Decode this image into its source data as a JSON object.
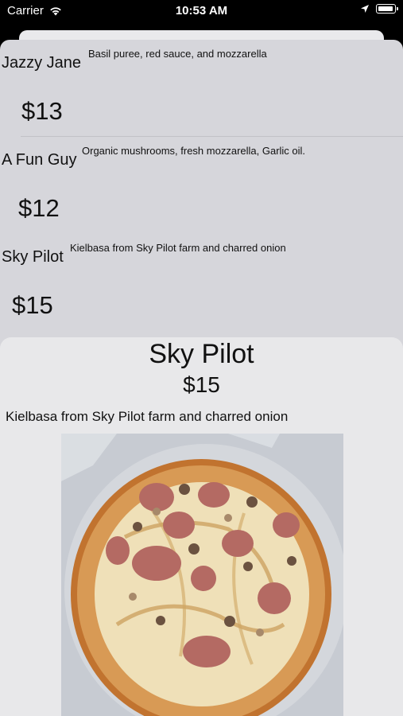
{
  "status_bar": {
    "carrier": "Carrier",
    "time": "10:53 AM"
  },
  "pizza_list": [
    {
      "name": "Jazzy Jane",
      "description": "Basil puree, red sauce, and mozzarella",
      "price": "$13"
    },
    {
      "name": "A Fun Guy",
      "description": "Organic mushrooms, fresh mozzarella, Garlic oil.",
      "price": "$12"
    },
    {
      "name": "Sky Pilot",
      "description": "Kielbasa from Sky Pilot farm and charred onion",
      "price": "$15"
    }
  ],
  "detail": {
    "title": "Sky Pilot",
    "price": "$15",
    "description": "Kielbasa from Sky Pilot farm and charred onion",
    "image_icon": "pizza-photo"
  },
  "colors": {
    "list_background": "#d6d6db",
    "detail_background": "#e8e8ea",
    "text": "#111111"
  }
}
